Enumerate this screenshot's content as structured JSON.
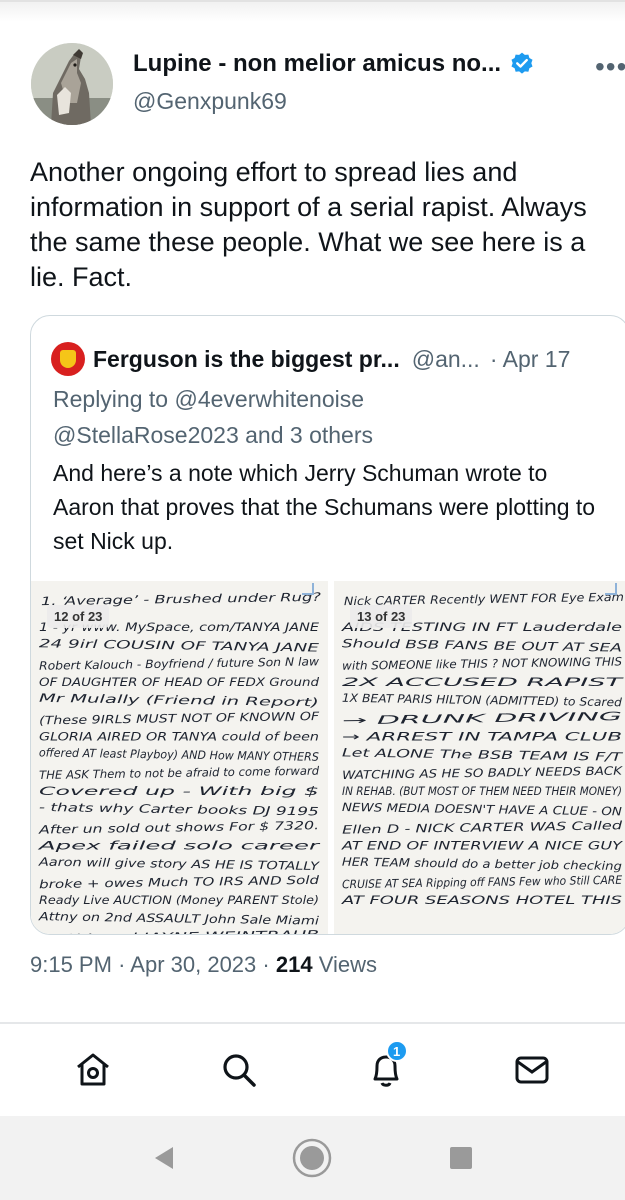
{
  "tweet": {
    "author_name": "Lupine - non melior amicus no...",
    "handle": "@Genxpunk69",
    "more_label": "•••",
    "text": "Another ongoing effort to spread lies and information in support of a serial rapist. Always the same these people. What we see here is a lie. Fact.",
    "time": "9:15 PM",
    "separator": "·",
    "date": "Apr 30, 2023",
    "views_count": "214",
    "views_label": "Views"
  },
  "quote": {
    "author_name": "Ferguson is the biggest pr...",
    "handle": "@an...",
    "date": "· Apr 17",
    "reply_prefix": "Replying to",
    "reply_to": "@4everwhitenoise",
    "reply_line2": "@StellaRose2023 and 3 others",
    "text": "And here’s a note which Jerry Schuman wrote to Aaron that proves that the Schumans were plotting to set Nick up.",
    "images": [
      {
        "badge": "12 of 23",
        "lines": [
          "1. ‘Average’ - Brushed under Rug?",
          "1 - yr www. MySpace, com/TANYA JANE",
          "24 9irl COUSIN OF TANYA JANE",
          "Robert Kalouch - Boyfriend / future Son N law",
          "OF DAUGHTER OF HEAD OF FEDX Ground",
          "Mr Mulally (Friend in Report)",
          "(These 9IRLS MUST NOT OF KNOWN OF",
          "GLORIA AIRED OR TANYA could of been",
          "offered AT least Playboy) AND How MANY OTHERS",
          "THE ASK Them to not be afraid to come forward",
          "Covered up - With big $",
          "- thats why Carter books DJ 9195",
          "After un sold out shows For $ 7320.",
          "Apex failed solo career",
          "Aaron will give story AS HE IS TOTALLY",
          "broke + owes Much TO IRS AND Sold",
          "Ready Live AUCTION (Money PARENT Stole)",
          "Attny on 2nd ASSAULT John Sale Miami",
          "CNN Legal JAYNE WEINTRAUB"
        ]
      },
      {
        "badge": "13 of 23",
        "lines": [
          "Nick CARTER Recently WENT FOR Eye Exam",
          "AIDS TESTING IN FT Lauderdale",
          "Should BSB FANS BE OUT AT SEA",
          "with SOMEONE like THIS ? NOT KNOWING THIS",
          "2X ACCUSED RAPIST",
          "1X BEAT PARIS HILTON (ADMITTED) to Scared",
          "→ DRUNK DRIVING",
          "→ ARREST IN TAMPA CLUB",
          "Let ALONE The BSB TEAM IS F/T",
          "WATCHING AS HE SO BADLY NEEDS BACK",
          "IN REHAB. (BUT MOST OF THEM NEED THEIR MONEY)",
          "NEWS MEDIA DOESN'T HAVE A CLUE - ON",
          "Ellen D - NICK CARTER WAS Called",
          "AT END OF INTERVIEW A NICE GUY",
          "HER TEAM should do a better job checking",
          "CRUISE AT SEA Ripping off FANS Few who Still CARE",
          "AT FOUR SEASONS HOTEL THIS"
        ]
      }
    ]
  },
  "tabs": [
    {
      "icon": "home-icon",
      "label": "Home"
    },
    {
      "icon": "search-icon",
      "label": "Search"
    },
    {
      "icon": "bell-icon",
      "label": "Notifications",
      "badge": "1"
    },
    {
      "icon": "mail-icon",
      "label": "Messages"
    }
  ],
  "system_nav": [
    {
      "icon": "back-icon"
    },
    {
      "icon": "home-circle-icon"
    },
    {
      "icon": "recents-icon"
    }
  ],
  "colors": {
    "accent": "#1d9bf0",
    "text": "#0f1419",
    "secondary": "#536471",
    "border": "#cfd9de"
  }
}
